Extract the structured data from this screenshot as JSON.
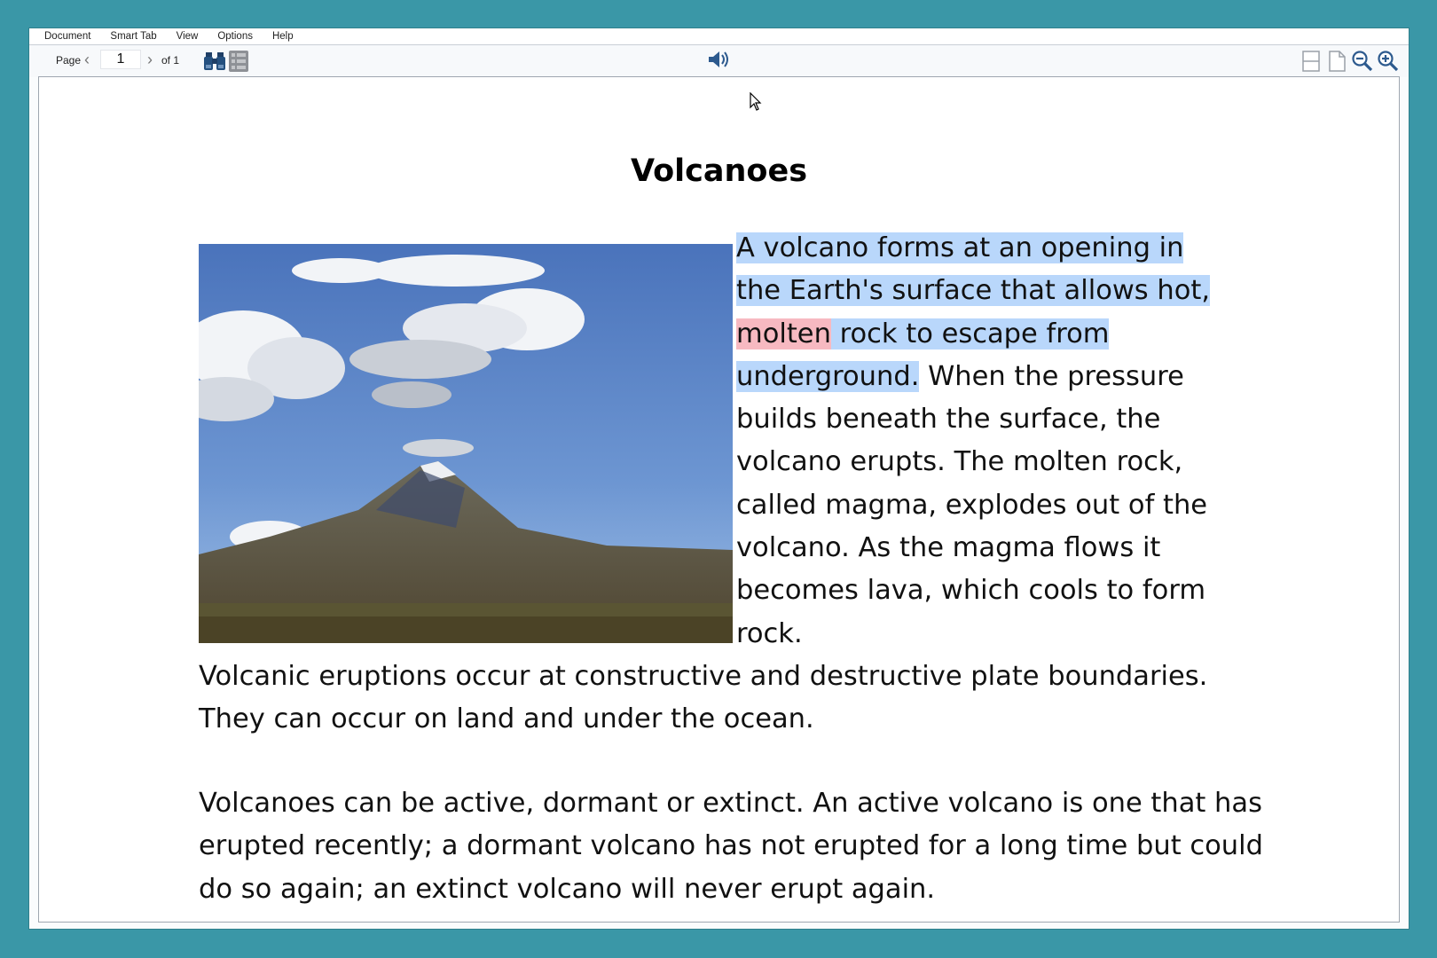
{
  "menu": [
    "Document",
    "Smart Tab",
    "View",
    "Options",
    "Help"
  ],
  "toolbar": {
    "page_label": "Page",
    "page_value": "1",
    "page_of": "of 1",
    "icons": [
      "prev-page-icon",
      "next-page-icon",
      "find-binoculars-icon",
      "list-view-icon",
      "speaker-icon",
      "single-page-layout-icon",
      "page-icon",
      "zoom-out-icon",
      "zoom-in-icon"
    ]
  },
  "document": {
    "title": "Volcanoes",
    "para1": {
      "hl_a": "A volcano forms at an opening in the Earth's surface that allows hot, ",
      "word": "molten",
      "hl_b": " rock to escape from underground.",
      "rest": " When the pressure builds beneath the surface, the volcano erupts. The molten rock, called magma, explodes out of the volcano. As the magma flows it becomes lava, which cools to form rock.",
      "wrap": "Volcanic eruptions occur at constructive and destructive plate boundaries. They can occur on land and under the ocean."
    },
    "para2": "Volcanoes can be active, dormant or extinct. An active volcano is one that has erupted recently; a dormant volcano has not erupted for a long time but could do so again; an extinct volcano will never erupt again."
  },
  "colors": {
    "background": "#3a97a7",
    "sentence_highlight": "#b9d7fb",
    "word_highlight": "#f7b9c1"
  }
}
